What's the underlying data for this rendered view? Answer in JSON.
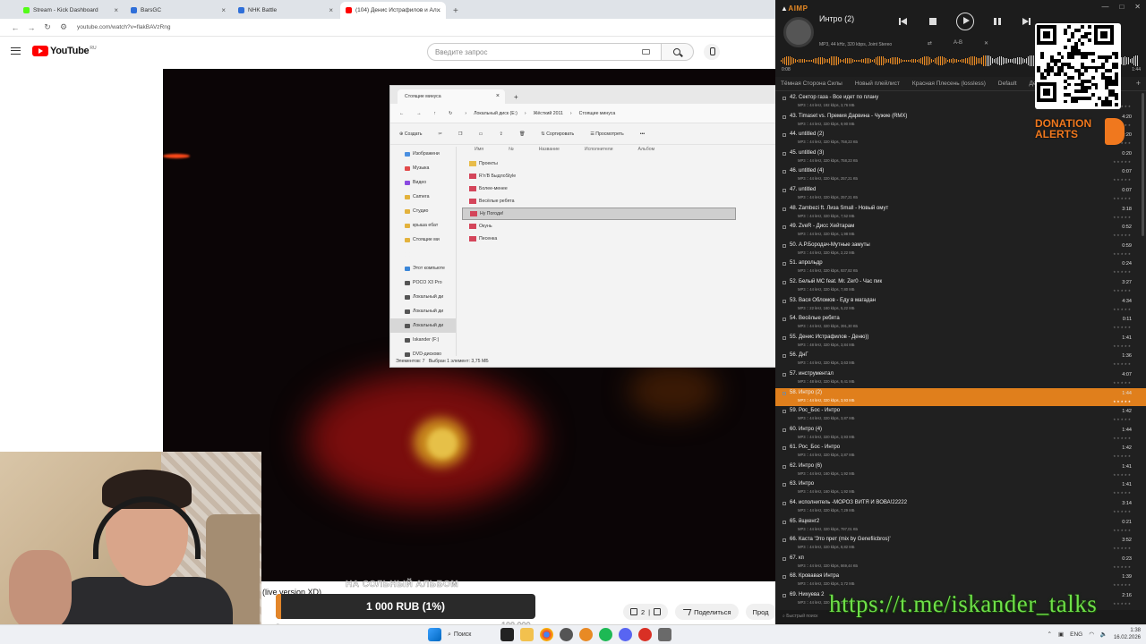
{
  "browser": {
    "tabs": [
      {
        "label": "Stream - Kick Dashboard",
        "color": "#53fc18",
        "active": false
      },
      {
        "label": "BarsGC",
        "color": "#2f6fd9",
        "active": false
      },
      {
        "label": "NHK Battle",
        "color": "#2f6fd9",
        "active": false
      },
      {
        "label": "(104) Денис Истрафилов и Ал...",
        "color": "#ff0000",
        "active": true
      }
    ],
    "url": "youtube.com/watch?v=flakBAVzRng"
  },
  "youtube": {
    "logo_text": "YouTube",
    "region": "RU",
    "search_placeholder": "Введите запрос",
    "title_snippet": "(live version XD)",
    "caption_ghost": "НА СОЛЬНЫЙ АЛЬБОМ",
    "likes": "2",
    "share_label": "Поделиться",
    "more_label": "Прод"
  },
  "explorer": {
    "tab_title": "Стоящие минуса",
    "breadcrumb": [
      "Локальный диск (E:)",
      "Жёсткий 2011",
      "Стоящие минуса"
    ],
    "toolbar": {
      "create": "Создать",
      "sort": "Сортировать",
      "view": "Просмотреть"
    },
    "sidebar": [
      {
        "label": "Изображени",
        "color": "#4a8fe0"
      },
      {
        "label": "Музыка",
        "color": "#e24a4a"
      },
      {
        "label": "Видео",
        "color": "#8a4ae0"
      },
      {
        "label": "Camera",
        "color": "#e3b23c"
      },
      {
        "label": "Студио",
        "color": "#e3b23c"
      },
      {
        "label": "крыша ебат",
        "color": "#e3b23c"
      },
      {
        "label": "Стоящие ми",
        "color": "#e3b23c"
      },
      {
        "label": "",
        "color": "#f3f3f3"
      },
      {
        "label": "Этот компьюте",
        "color": "#3a86d8"
      },
      {
        "label": "POCO X3 Pro",
        "color": "#555"
      },
      {
        "label": "Локальный ди",
        "color": "#555"
      },
      {
        "label": "Локальный ди",
        "color": "#555"
      },
      {
        "label": "Локальный ди",
        "color": "#555"
      },
      {
        "label": "Iskander (F:)",
        "color": "#555"
      },
      {
        "label": "DVD-дисково",
        "color": "#555"
      }
    ],
    "columns": [
      "Имя",
      "№",
      "Название",
      "Исполнители",
      "Альбом"
    ],
    "files": [
      {
        "name": "Проекты",
        "type": "folder"
      },
      {
        "name": "R'n'B БыдлоStyle",
        "type": "audio"
      },
      {
        "name": "Более-менее",
        "type": "audio"
      },
      {
        "name": "Весёлые ребята",
        "type": "audio"
      },
      {
        "name": "Ну Погоди!",
        "type": "audio"
      },
      {
        "name": "Окунь",
        "type": "audio"
      },
      {
        "name": "Песенка",
        "type": "audio"
      }
    ],
    "status_left": "Элементов: 7",
    "status_right": "Выбран 1 элемент: 3,75 МБ"
  },
  "donation": {
    "label": "1 000 RUB (1%)",
    "progress_percent": 1,
    "ghost_total": "100 000",
    "ghost_zero": "0"
  },
  "taskbar": {
    "search_label": "Поиск",
    "lang": "ENG",
    "time": "1:38",
    "date": "16.02.2026"
  },
  "aimp": {
    "logo": "AIMP",
    "track_title": "Интро (2)",
    "track_info": "MP3, 44 kHz, 320 kbps, Joint Stereo",
    "ab_label": "A-B",
    "elapsed": "0:08",
    "total": "1:44",
    "playlist_tabs": [
      "Тёмная Сторона Силы",
      "Новый плейлист",
      "Красная Плесень (lossless)",
      "Default",
      "Денис"
    ],
    "quick_search": "Быстрый поиск",
    "tracks": [
      {
        "title": "42. Сектор газа - Все идет по плану",
        "meta": "MP3 :: 44 kHz, 192 kbps, 3,76 МБ",
        "dur": "",
        "current": false
      },
      {
        "title": "43. Timaset vs. Премия Дарвина - Чужие (RMX)",
        "meta": "MP3 :: 44 kHz, 320 kbps, 9,90 МБ",
        "dur": "4:20",
        "current": false
      },
      {
        "title": "44. untitled (2)",
        "meta": "MP3 :: 44 kHz, 320 kbps, 758,23 КБ",
        "dur": "0:20",
        "current": false
      },
      {
        "title": "45. untitled (3)",
        "meta": "MP3 :: 44 kHz, 320 kbps, 758,23 КБ",
        "dur": "0:20",
        "current": false
      },
      {
        "title": "46. untitled (4)",
        "meta": "MP3 :: 44 kHz, 320 kbps, 257,21 КБ",
        "dur": "0:07",
        "current": false
      },
      {
        "title": "47. untitled",
        "meta": "MP3 :: 44 kHz, 320 kbps, 257,21 КБ",
        "dur": "0:07",
        "current": false
      },
      {
        "title": "48. Zambezi ft. Лиза Small - Новый омут",
        "meta": "MP3 :: 44 kHz, 320 kbps, 7,52 МБ",
        "dur": "3:18",
        "current": false
      },
      {
        "title": "49. ZveR - Дисс Хейтарам",
        "meta": "MP3 :: 44 kHz, 320 kbps, 1,98 МБ",
        "dur": "0:52",
        "current": false
      },
      {
        "title": "50. А.Р.Бородач-Мутные замуты",
        "meta": "MP3 :: 44 kHz, 320 kbps, 2,22 МБ",
        "dur": "0:59",
        "current": false
      },
      {
        "title": "51. апрольдр",
        "meta": "MP3 :: 44 kHz, 320 kbps, 937,82 КБ",
        "dur": "0:24",
        "current": false
      },
      {
        "title": "52. Белый MC feat. Mr. Zer0 - Час пик",
        "meta": "MP3 :: 44 kHz, 320 kbps, 7,80 МБ",
        "dur": "3:27",
        "current": false
      },
      {
        "title": "53. Вася Обломов - Еду в магадан",
        "meta": "MP3 :: 22 kHz, 160 kbps, 5,22 МБ",
        "dur": "4:34",
        "current": false
      },
      {
        "title": "54. Весёлые ребята",
        "meta": "MP3 :: 44 kHz, 320 kbps, 391,30 КБ",
        "dur": "0:11",
        "current": false
      },
      {
        "title": "55. Денис Истрафилов - Деню))",
        "meta": "MP3 :: 48 kHz, 320 kbps, 3,84 МБ",
        "dur": "1:41",
        "current": false
      },
      {
        "title": "56. ДнГ",
        "meta": "MP3 :: 44 kHz, 320 kbps, 3,63 МБ",
        "dur": "1:36",
        "current": false
      },
      {
        "title": "57. инструментал",
        "meta": "MP3 :: 48 kHz, 320 kbps, 9,41 МБ",
        "dur": "4:07",
        "current": false
      },
      {
        "title": "58. Интро (2)",
        "meta": "MP3 :: 44 kHz, 320 kbps, 3,93 МБ",
        "dur": "1:44",
        "current": true
      },
      {
        "title": "59. Рос_Бос - Интро",
        "meta": "MP3 :: 44 kHz, 320 kbps, 3,87 МБ",
        "dur": "1:42",
        "current": false
      },
      {
        "title": "60. Интро (4)",
        "meta": "MP3 :: 44 kHz, 320 kbps, 3,93 МБ",
        "dur": "1:44",
        "current": false
      },
      {
        "title": "61. Рос_Бос - Интро",
        "meta": "MP3 :: 44 kHz, 320 kbps, 3,87 МБ",
        "dur": "1:42",
        "current": false
      },
      {
        "title": "62. Интро (6)",
        "meta": "MP3 :: 44 kHz, 160 kbps, 1,92 МБ",
        "dur": "1:41",
        "current": false
      },
      {
        "title": "63. Интро",
        "meta": "MP3 :: 44 kHz, 160 kbps, 1,92 МБ",
        "dur": "1:41",
        "current": false
      },
      {
        "title": "64. исполнитель -МОРОЗ ВИТЯ И ВОВА!22222",
        "meta": "MP3 :: 44 kHz, 320 kbps, 7,29 МБ",
        "dur": "3:14",
        "current": false
      },
      {
        "title": "65. йщкенг2",
        "meta": "MP3 :: 44 kHz, 320 kbps, 797,01 КБ",
        "dur": "0:21",
        "current": false
      },
      {
        "title": "66. Каста 'Это прет (mix by Genefiicbros)'",
        "meta": "MP3 :: 44 kHz, 320 kbps, 8,82 МБ",
        "dur": "3:52",
        "current": false
      },
      {
        "title": "67. кп",
        "meta": "MP3 :: 44 kHz, 320 kbps, 869,44 КБ",
        "dur": "0:23",
        "current": false
      },
      {
        "title": "68. Кровавая Интра",
        "meta": "MP3 :: 44 kHz, 320 kbps, 3,72 МБ",
        "dur": "1:39",
        "current": false
      },
      {
        "title": "69. Нихуева 2",
        "meta": "MP3 :: 44 kHz, 320 kbps, 5,95 МБ",
        "dur": "2:16",
        "current": false
      }
    ]
  },
  "overlays": {
    "donation_alerts": "DONATION ALERTS",
    "telegram": "https://t.me/iskander_talks"
  }
}
